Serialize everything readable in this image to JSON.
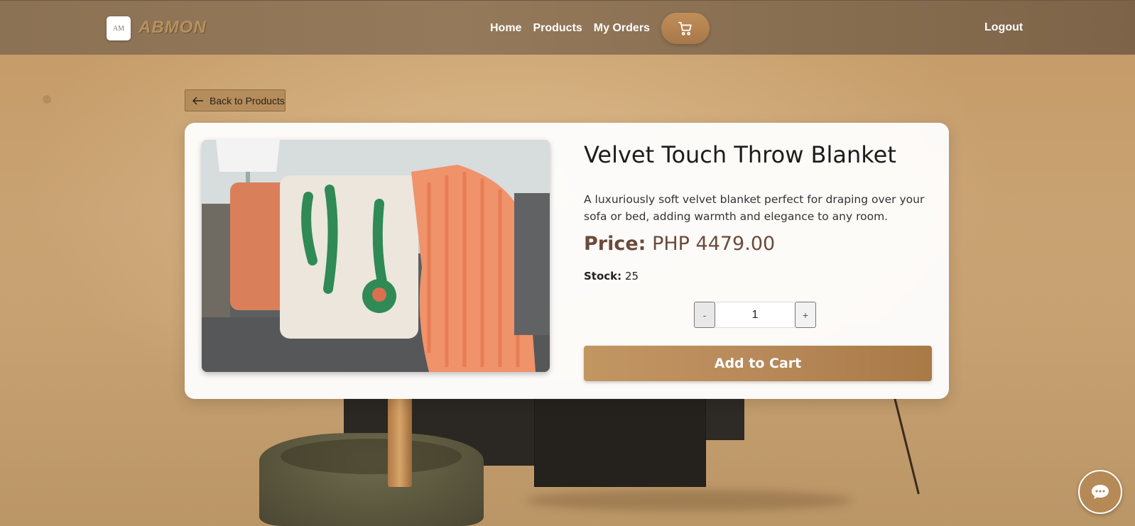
{
  "brand": {
    "name": "ABMON"
  },
  "nav": {
    "links": [
      "Home",
      "Products",
      "My Orders"
    ],
    "logout": "Logout"
  },
  "back_button": {
    "label": "Back to Products"
  },
  "product": {
    "title": "Velvet Touch Throw Blanket",
    "description": "A luxuriously soft velvet blanket perfect for draping over your sofa or bed, adding warmth and elegance to any room.",
    "price_label": "Price:",
    "price_value": "PHP 4479.00",
    "stock_label": "Stock:",
    "stock_value": "25",
    "image_alt": "Throw blanket with cactus pillows on sofa"
  },
  "quantity": {
    "minus": "-",
    "value": "1",
    "plus": "+"
  },
  "add_to_cart": {
    "label": "Add to Cart"
  },
  "colors": {
    "accent": "#b8895a",
    "navbar": "#8c7254",
    "price": "#6b4a3a"
  }
}
